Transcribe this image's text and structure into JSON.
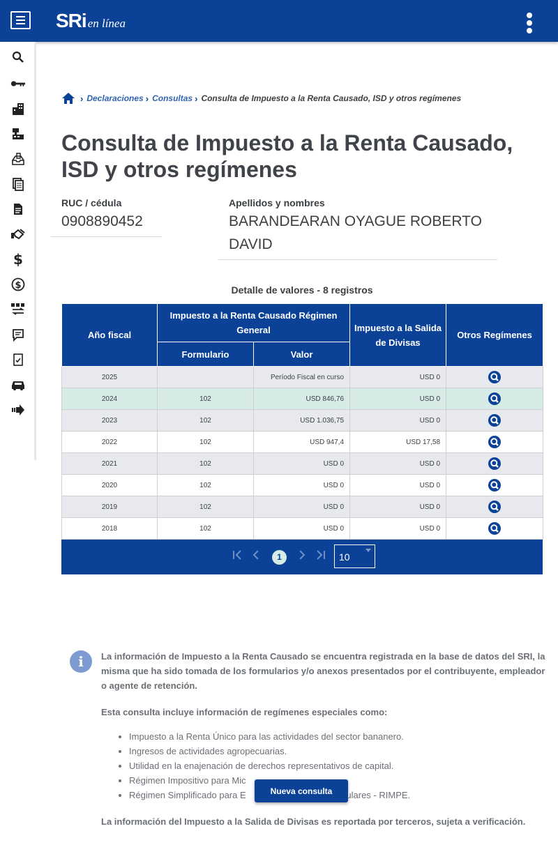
{
  "header": {
    "logo_main": "SRi",
    "logo_sub": "en línea"
  },
  "sidebar": {
    "icons": [
      "search-icon",
      "key-icon",
      "buildings-icon",
      "cash-register-icon",
      "inbox-tray-icon",
      "documents-icon",
      "document-icon",
      "handshake-icon",
      "dollar-icon",
      "dollar-circle-icon",
      "currency-exchange-icon",
      "comment-edit-icon",
      "checklist-icon",
      "car-icon",
      "arrow-right-icon"
    ]
  },
  "breadcrumb": {
    "item1": "Declaraciones",
    "item2": "Consultas",
    "current": "Consulta de Impuesto a la Renta Causado, ISD y otros regímenes"
  },
  "page": {
    "title": "Consulta de Impuesto a la Renta Causado, ISD y otros regímenes"
  },
  "taxpayer": {
    "ruc_label": "RUC / cédula",
    "ruc_value": "0908890452",
    "name_label": "Apellidos y nombres",
    "name_value": "BARANDEARAN OYAGUE ROBERTO DAVID"
  },
  "table": {
    "caption": "Detalle de valores - 8 registros",
    "headers": {
      "year": "Año fiscal",
      "group": "Impuesto a la Renta Causado Régimen General",
      "form": "Formulario",
      "value": "Valor",
      "isd": "Impuesto a la Salida de Divisas",
      "others": "Otros Regímenes"
    },
    "rows": [
      {
        "year": "2025",
        "form": "",
        "value": "Período Fiscal en curso",
        "isd": "USD 0"
      },
      {
        "year": "2024",
        "form": "102",
        "value": "USD 846,76",
        "isd": "USD 0"
      },
      {
        "year": "2023",
        "form": "102",
        "value": "USD 1.036,75",
        "isd": "USD 0"
      },
      {
        "year": "2022",
        "form": "102",
        "value": "USD 947,4",
        "isd": "USD 17,58"
      },
      {
        "year": "2021",
        "form": "102",
        "value": "USD 0",
        "isd": "USD 0"
      },
      {
        "year": "2020",
        "form": "102",
        "value": "USD 0",
        "isd": "USD 0"
      },
      {
        "year": "2019",
        "form": "102",
        "value": "USD 0",
        "isd": "USD 0"
      },
      {
        "year": "2018",
        "form": "102",
        "value": "USD 0",
        "isd": "USD 0"
      }
    ]
  },
  "pager": {
    "first": "|<",
    "prev": "<",
    "page": "1",
    "next": ">",
    "last": ">|",
    "page_size": "10"
  },
  "info": {
    "paragraph1": "La información de Impuesto a la Renta Causado se encuentra registrada en la base de datos del SRI, la misma que ha sido tomada de los formularios y/o anexos presentados por el contribuyente, empleador o agente de retención.",
    "paragraph2": "Esta consulta incluye información de regímenes especiales como:",
    "items": [
      "Impuesto a la Renta Único para las actividades del sector bananero.",
      "Ingresos de actividades agropecuarias.",
      "Utilidad en la enajenación de derechos representativos de capital.",
      "Régimen Impositivo para Mic",
      "Régimen Simplificado para E                          cios Populares - RIMPE."
    ],
    "paragraph3": "La información del Impuesto a la Salida de Divisas es reportada por terceros, sujeta a verificación."
  },
  "actions": {
    "new_query": "Nueva consulta"
  },
  "colors": {
    "brand": "#0b4298",
    "row_gray": "#e8e9ee",
    "row_highlight": "#d6ebe5"
  }
}
